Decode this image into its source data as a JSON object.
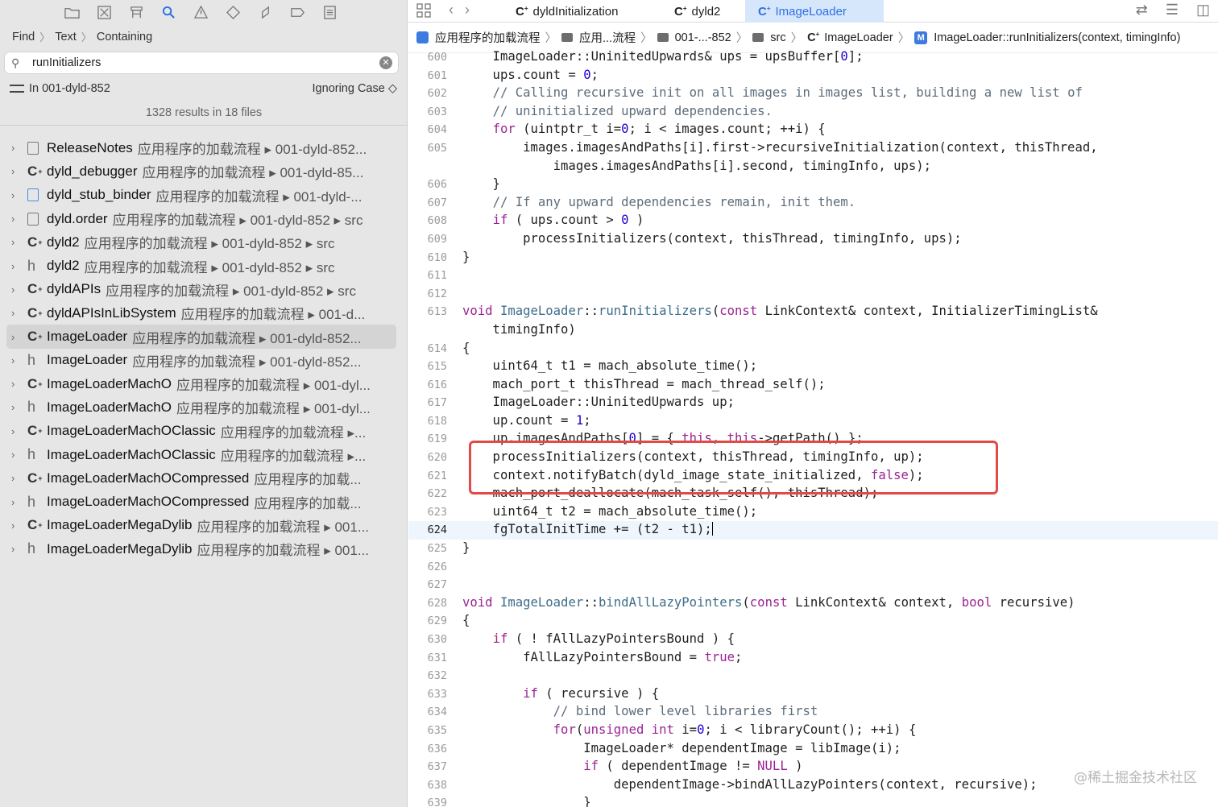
{
  "navigator": {
    "find_mode": "Find",
    "find_kind": "Text",
    "find_match": "Containing",
    "search_value": "runInitializers",
    "scope": "In 001-dyld-852",
    "case_option": "Ignoring Case ◇",
    "summary": "1328 results in 18 files",
    "results": [
      {
        "icon": "doc",
        "name": "ReleaseNotes",
        "path": "应用程序的加载流程 ▸ 001-dyld-852..."
      },
      {
        "icon": "c",
        "name": "dyld_debugger",
        "path": "应用程序的加载流程 ▸ 001-dyld-85..."
      },
      {
        "icon": "doc-blue",
        "name": "dyld_stub_binder",
        "path": "应用程序的加载流程 ▸ 001-dyld-..."
      },
      {
        "icon": "doc",
        "name": "dyld.order",
        "path": "应用程序的加载流程 ▸ 001-dyld-852 ▸ src"
      },
      {
        "icon": "c",
        "name": "dyld2",
        "path": "应用程序的加载流程 ▸ 001-dyld-852 ▸ src"
      },
      {
        "icon": "h",
        "name": "dyld2",
        "path": "应用程序的加载流程 ▸ 001-dyld-852 ▸ src"
      },
      {
        "icon": "c",
        "name": "dyldAPIs",
        "path": "应用程序的加载流程 ▸ 001-dyld-852 ▸ src"
      },
      {
        "icon": "c",
        "name": "dyldAPIsInLibSystem",
        "path": "应用程序的加载流程 ▸ 001-d..."
      },
      {
        "icon": "c",
        "name": "ImageLoader",
        "path": "应用程序的加载流程 ▸ 001-dyld-852...",
        "selected": true
      },
      {
        "icon": "h",
        "name": "ImageLoader",
        "path": "应用程序的加载流程 ▸ 001-dyld-852..."
      },
      {
        "icon": "c",
        "name": "ImageLoaderMachO",
        "path": "应用程序的加载流程 ▸ 001-dyl..."
      },
      {
        "icon": "h",
        "name": "ImageLoaderMachO",
        "path": "应用程序的加载流程 ▸ 001-dyl..."
      },
      {
        "icon": "c",
        "name": "ImageLoaderMachOClassic",
        "path": "应用程序的加载流程 ▸..."
      },
      {
        "icon": "h",
        "name": "ImageLoaderMachOClassic",
        "path": "应用程序的加载流程 ▸..."
      },
      {
        "icon": "c",
        "name": "ImageLoaderMachOCompressed",
        "path": "应用程序的加载..."
      },
      {
        "icon": "h",
        "name": "ImageLoaderMachOCompressed",
        "path": "应用程序的加载..."
      },
      {
        "icon": "c",
        "name": "ImageLoaderMegaDylib",
        "path": "应用程序的加载流程 ▸ 001..."
      },
      {
        "icon": "h",
        "name": "ImageLoaderMegaDylib",
        "path": "应用程序的加载流程 ▸ 001..."
      }
    ]
  },
  "editor": {
    "tabs": [
      "dyldInitialization",
      "dyld2",
      "ImageLoader"
    ],
    "active_tab": "ImageLoader",
    "breadcrumb": [
      "应用程序的加载流程",
      "应用...流程",
      "001-...-852",
      "src",
      "ImageLoader",
      "ImageLoader::runInitializers(context, timingInfo)"
    ],
    "current_line": "624",
    "lines": [
      {
        "n": "600",
        "t": "    ImageLoader::UninitedUpwards& ups = upsBuffer[0];"
      },
      {
        "n": "601",
        "t": "    ups.count = 0;"
      },
      {
        "n": "602",
        "t": "    // Calling recursive init on all images in images list, building a new list of"
      },
      {
        "n": "603",
        "t": "    // uninitialized upward dependencies."
      },
      {
        "n": "604",
        "t": "    for (uintptr_t i=0; i < images.count; ++i) {"
      },
      {
        "n": "605",
        "t": "        images.imagesAndPaths[i].first->recursiveInitialization(context, thisThread,"
      },
      {
        "n": "",
        "t": "            images.imagesAndPaths[i].second, timingInfo, ups);"
      },
      {
        "n": "606",
        "t": "    }"
      },
      {
        "n": "607",
        "t": "    // If any upward dependencies remain, init them."
      },
      {
        "n": "608",
        "t": "    if ( ups.count > 0 )"
      },
      {
        "n": "609",
        "t": "        processInitializers(context, thisThread, timingInfo, ups);"
      },
      {
        "n": "610",
        "t": "}"
      },
      {
        "n": "611",
        "t": ""
      },
      {
        "n": "612",
        "t": ""
      },
      {
        "n": "613",
        "t": "void ImageLoader::runInitializers(const LinkContext& context, InitializerTimingList&"
      },
      {
        "n": "",
        "t": "    timingInfo)"
      },
      {
        "n": "614",
        "t": "{"
      },
      {
        "n": "615",
        "t": "    uint64_t t1 = mach_absolute_time();"
      },
      {
        "n": "616",
        "t": "    mach_port_t thisThread = mach_thread_self();"
      },
      {
        "n": "617",
        "t": "    ImageLoader::UninitedUpwards up;"
      },
      {
        "n": "618",
        "t": "    up.count = 1;"
      },
      {
        "n": "619",
        "t": "    up.imagesAndPaths[0] = { this, this->getPath() };"
      },
      {
        "n": "620",
        "t": "    processInitializers(context, thisThread, timingInfo, up);"
      },
      {
        "n": "621",
        "t": "    context.notifyBatch(dyld_image_state_initialized, false);"
      },
      {
        "n": "622",
        "t": "    mach_port_deallocate(mach_task_self(), thisThread);"
      },
      {
        "n": "623",
        "t": "    uint64_t t2 = mach_absolute_time();"
      },
      {
        "n": "624",
        "t": "    fgTotalInitTime += (t2 - t1);"
      },
      {
        "n": "625",
        "t": "}"
      },
      {
        "n": "626",
        "t": ""
      },
      {
        "n": "627",
        "t": ""
      },
      {
        "n": "628",
        "t": "void ImageLoader::bindAllLazyPointers(const LinkContext& context, bool recursive)"
      },
      {
        "n": "629",
        "t": "{"
      },
      {
        "n": "630",
        "t": "    if ( ! fAllLazyPointersBound ) {"
      },
      {
        "n": "631",
        "t": "        fAllLazyPointersBound = true;"
      },
      {
        "n": "632",
        "t": ""
      },
      {
        "n": "633",
        "t": "        if ( recursive ) {"
      },
      {
        "n": "634",
        "t": "            // bind lower level libraries first"
      },
      {
        "n": "635",
        "t": "            for(unsigned int i=0; i < libraryCount(); ++i) {"
      },
      {
        "n": "636",
        "t": "                ImageLoader* dependentImage = libImage(i);"
      },
      {
        "n": "637",
        "t": "                if ( dependentImage != NULL )"
      },
      {
        "n": "638",
        "t": "                    dependentImage->bindAllLazyPointers(context, recursive);"
      },
      {
        "n": "639",
        "t": "                }"
      }
    ]
  },
  "watermark": "@稀土掘金技术社区",
  "colors": {
    "keyword": "#9b2393",
    "number": "#1c00cf",
    "comment": "#5d6c79",
    "highlight": "#e24b45",
    "accent": "#2f6fe4"
  }
}
